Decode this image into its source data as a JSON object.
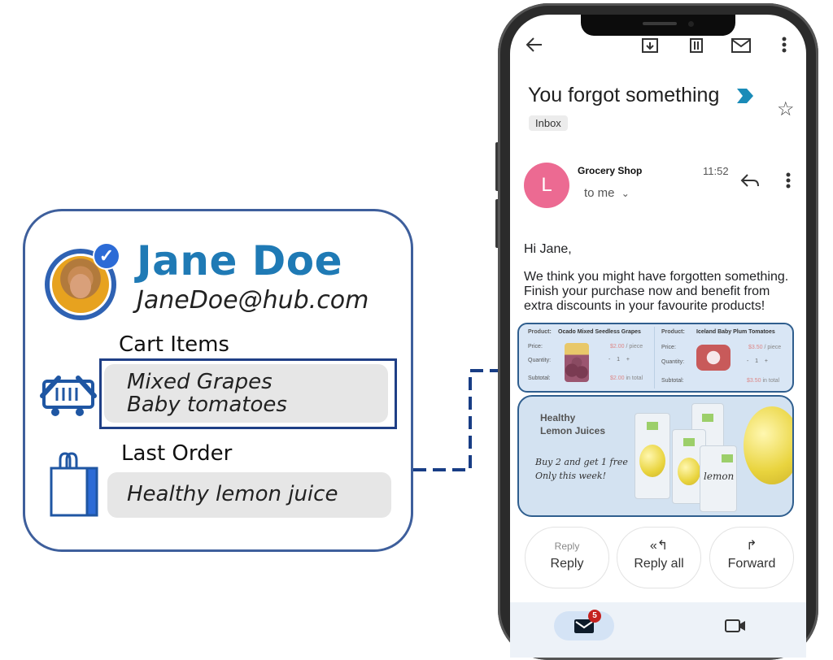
{
  "profile": {
    "name": "Jane Doe",
    "email": "JaneDoe@hub.com",
    "verified": true,
    "cart_label": "Cart Items",
    "cart_items": [
      "Mixed Grapes",
      "Baby tomatoes"
    ],
    "last_order_label": "Last Order",
    "last_order": "Healthy lemon juice",
    "accent_color": "#1f7ab5",
    "border_color": "#3e5f9c"
  },
  "email_app": {
    "toolbar": {
      "back_icon": "arrow-left-icon",
      "archive_icon": "archive-icon",
      "delete_icon": "trash-icon",
      "mark_unread_icon": "mail-icon",
      "more_icon": "more-vert-icon"
    },
    "subject": "You forgot something",
    "label": "Inbox",
    "sender": {
      "initial": "L",
      "name": "Grocery Shop",
      "recipient": "to me",
      "time": "11:52",
      "avatar_color": "#ec6a92"
    },
    "body": {
      "greeting": "Hi Jane,",
      "lines": [
        "We think you might have forgotten something.",
        "Finish your purchase now and benefit from",
        "extra discounts in your favourite products!"
      ]
    },
    "cart_products": [
      {
        "product_label": "Product:",
        "product_name": "Ocado Mixed Seedless Grapes",
        "price_label": "Price:",
        "price": "$2.00",
        "price_unit": "/ piece",
        "quantity_label": "Quantity:",
        "quantity": "1",
        "subtotal_label": "Subtotal:",
        "subtotal": "$2.00",
        "subtotal_suffix": "in total"
      },
      {
        "product_label": "Product:",
        "product_name": "Iceland Baby Plum Tomatoes",
        "price_label": "Price:",
        "price": "$3.50",
        "price_unit": "/ piece",
        "quantity_label": "Quantity:",
        "quantity": "1",
        "subtotal_label": "Subtotal:",
        "subtotal": "$3.50",
        "subtotal_suffix": "in total"
      }
    ],
    "promo": {
      "title_line1": "Healthy",
      "title_line2": "Lemon Juices",
      "offer_line1": "Buy 2 and get 1 free",
      "offer_line2": "Only this week!",
      "can_text": "lemon"
    },
    "actions": [
      {
        "label": "Reply",
        "icon_caption": "Reply"
      },
      {
        "label": "Reply all",
        "icon": "reply-all-icon"
      },
      {
        "label": "Forward",
        "icon": "forward-icon"
      }
    ],
    "bottom_nav": {
      "mail_badge": "5"
    }
  }
}
